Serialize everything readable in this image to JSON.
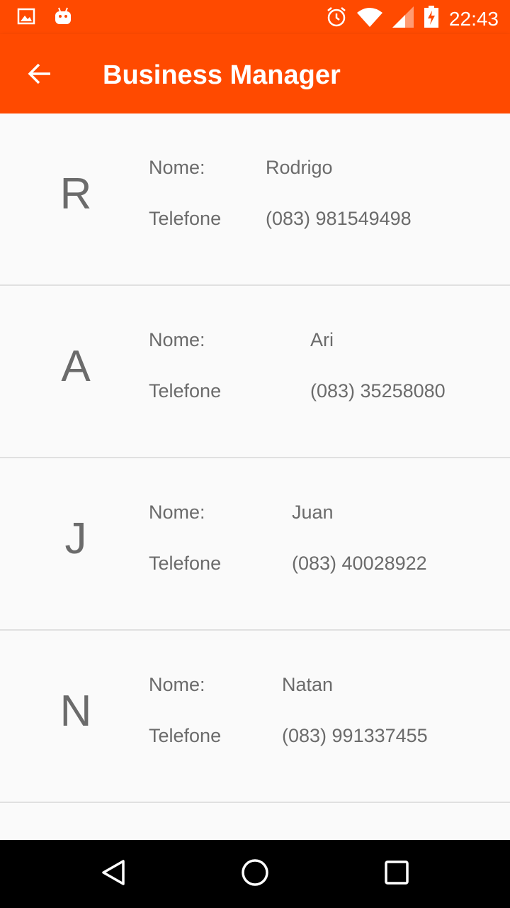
{
  "status_bar": {
    "time": "22:43",
    "icons": [
      "image-notification-icon",
      "android-notification-icon",
      "alarm-icon",
      "wifi-icon",
      "signal-icon",
      "battery-charging-icon"
    ]
  },
  "app_bar": {
    "title": "Business Manager",
    "back_icon": "arrow-back-icon",
    "background_color": "#ff4a00"
  },
  "contacts": [
    {
      "initial": "R",
      "name_label": "Nome:",
      "name": "Rodrigo",
      "phone_label": "Telefone",
      "phone": "(083) 981549498"
    },
    {
      "initial": "A",
      "name_label": "Nome:",
      "name": "Ari",
      "phone_label": "Telefone",
      "phone": "(083) 35258080"
    },
    {
      "initial": "J",
      "name_label": "Nome:",
      "name": "Juan",
      "phone_label": "Telefone",
      "phone": "(083) 40028922"
    },
    {
      "initial": "N",
      "name_label": "Nome:",
      "name": "Natan",
      "phone_label": "Telefone",
      "phone": "(083) 991337455"
    }
  ],
  "nav_bar": {
    "buttons": [
      "back-triangle-icon",
      "home-circle-icon",
      "recents-square-icon"
    ]
  }
}
